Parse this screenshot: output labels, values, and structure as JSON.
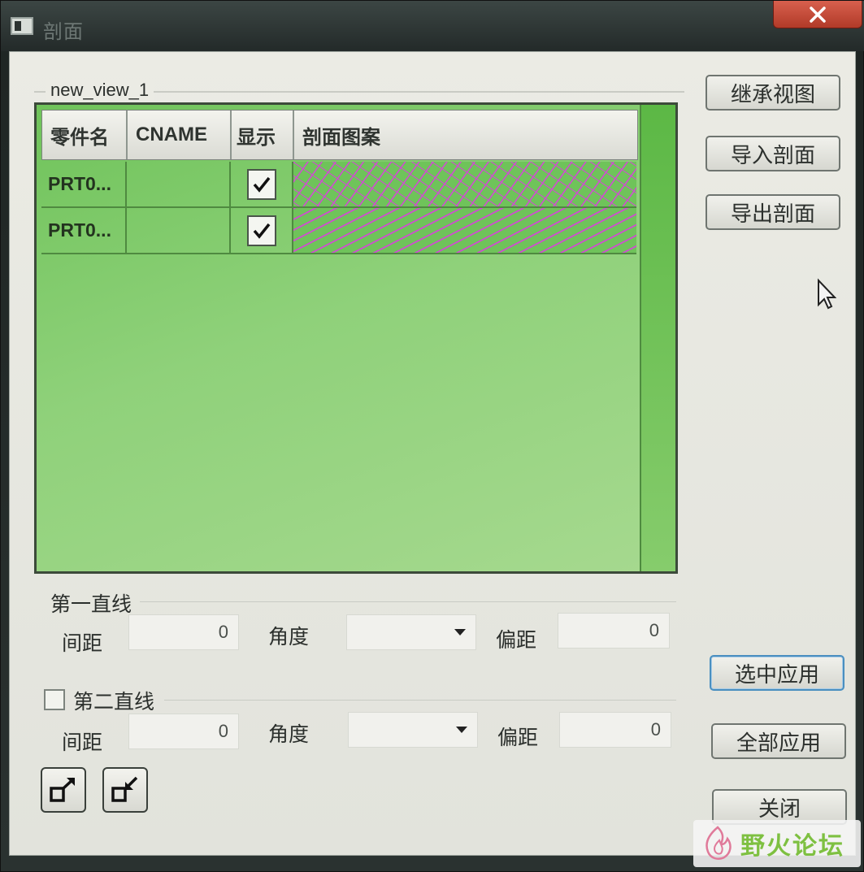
{
  "window": {
    "title": "剖面",
    "close_glyph": "✕"
  },
  "view_group": {
    "label": "new_view_1"
  },
  "table": {
    "columns": [
      "零件名",
      "CNAME",
      "显示",
      "剖面图案"
    ],
    "rows": [
      {
        "part_name": "PRT0...",
        "cname": "",
        "visible": true,
        "pattern": "crosshatch"
      },
      {
        "part_name": "PRT0...",
        "cname": "",
        "visible": true,
        "pattern": "diagonal-hatch"
      }
    ],
    "hatch_color": "#d645d8",
    "row_bg": "#6fc35a"
  },
  "right_buttons": {
    "inherit_view": "继承视图",
    "import_section": "导入剖面",
    "export_section": "导出剖面",
    "apply_selected": "选中应用",
    "apply_all": "全部应用",
    "close": "关闭"
  },
  "line1": {
    "title": "第一直线",
    "spacing_label": "间距",
    "spacing_value": "0",
    "angle_label": "角度",
    "angle_value": "",
    "offset_label": "偏距",
    "offset_value": "0"
  },
  "line2": {
    "title": "第二直线",
    "checked": false,
    "spacing_label": "间距",
    "spacing_value": "0",
    "angle_label": "角度",
    "angle_value": "",
    "offset_label": "偏距",
    "offset_value": "0"
  },
  "icons": {
    "expand": "expand-arrow-icon",
    "shrink": "shrink-arrow-icon"
  },
  "watermark": {
    "text": "野火论坛"
  }
}
